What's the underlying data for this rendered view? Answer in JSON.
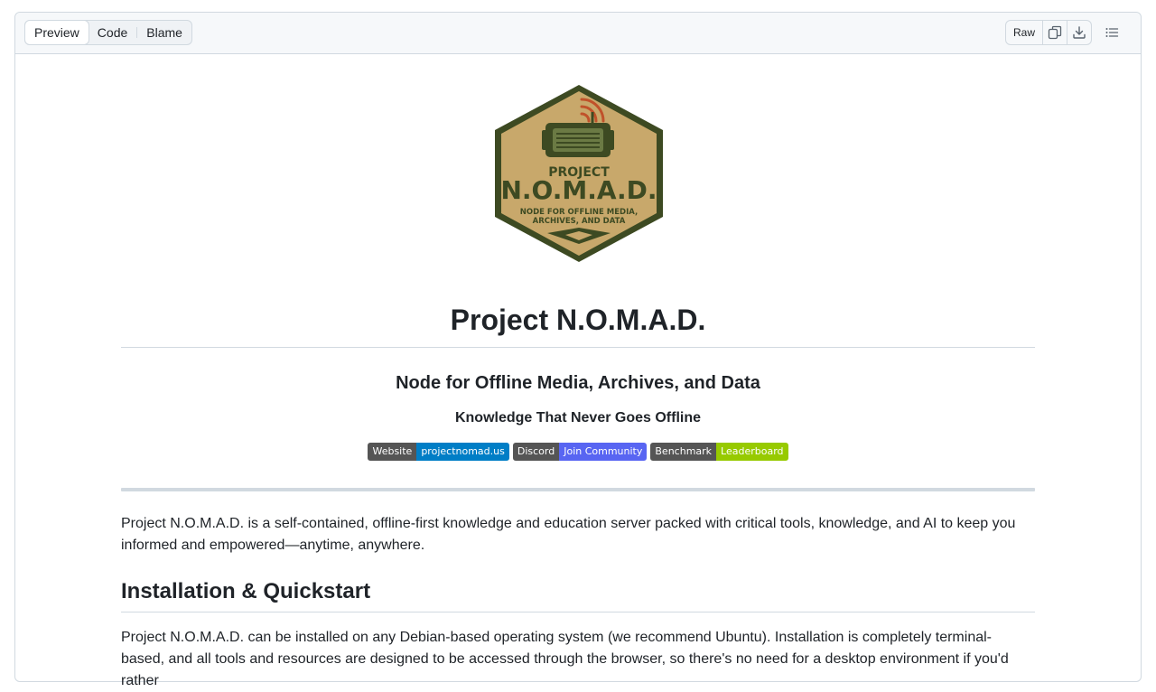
{
  "toolbar": {
    "tabs": [
      "Preview",
      "Code",
      "Blame"
    ],
    "raw_label": "Raw",
    "icons": [
      "copy-icon",
      "download-icon",
      "outline-icon"
    ]
  },
  "logo": {
    "line1": "PROJECT",
    "line2": "N.O.M.A.D.",
    "line3": "NODE FOR OFFLINE MEDIA,",
    "line4": "ARCHIVES, AND DATA",
    "colors": {
      "badge_fill": "#c8a86b",
      "border": "#3d4a22",
      "signal": "#c0522a"
    }
  },
  "readme": {
    "title": "Project N.O.M.A.D.",
    "subtitle": "Node for Offline Media, Archives, and Data",
    "tagline": "Knowledge That Never Goes Offline",
    "badges": [
      {
        "label": "Website",
        "value": "projectnomad.us",
        "color": "#007ec6"
      },
      {
        "label": "Discord",
        "value": "Join Community",
        "color": "#5865f2"
      },
      {
        "label": "Benchmark",
        "value": "Leaderboard",
        "color": "#97ca00"
      }
    ],
    "intro": "Project N.O.M.A.D. is a self-contained, offline-first knowledge and education server packed with critical tools, knowledge, and AI to keep you informed and empowered—anytime, anywhere.",
    "section_heading": "Installation & Quickstart",
    "install_text": "Project N.O.M.A.D. can be installed on any Debian-based operating system (we recommend Ubuntu). Installation is completely terminal-based, and all tools and resources are designed to be accessed through the browser, so there's no need for a desktop environment if you'd rather"
  }
}
